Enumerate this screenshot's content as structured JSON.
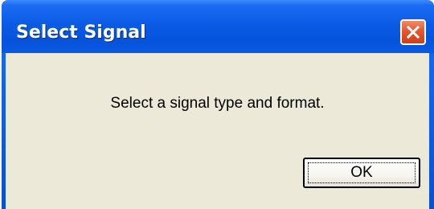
{
  "dialog": {
    "title": "Select Signal",
    "message": "Select a signal type and format.",
    "ok_label": "OK"
  },
  "icons": {
    "close": "close-icon"
  },
  "colors": {
    "titlebar": "#0a58e0",
    "close_button": "#e2582f",
    "panel": "#ece9d8"
  }
}
